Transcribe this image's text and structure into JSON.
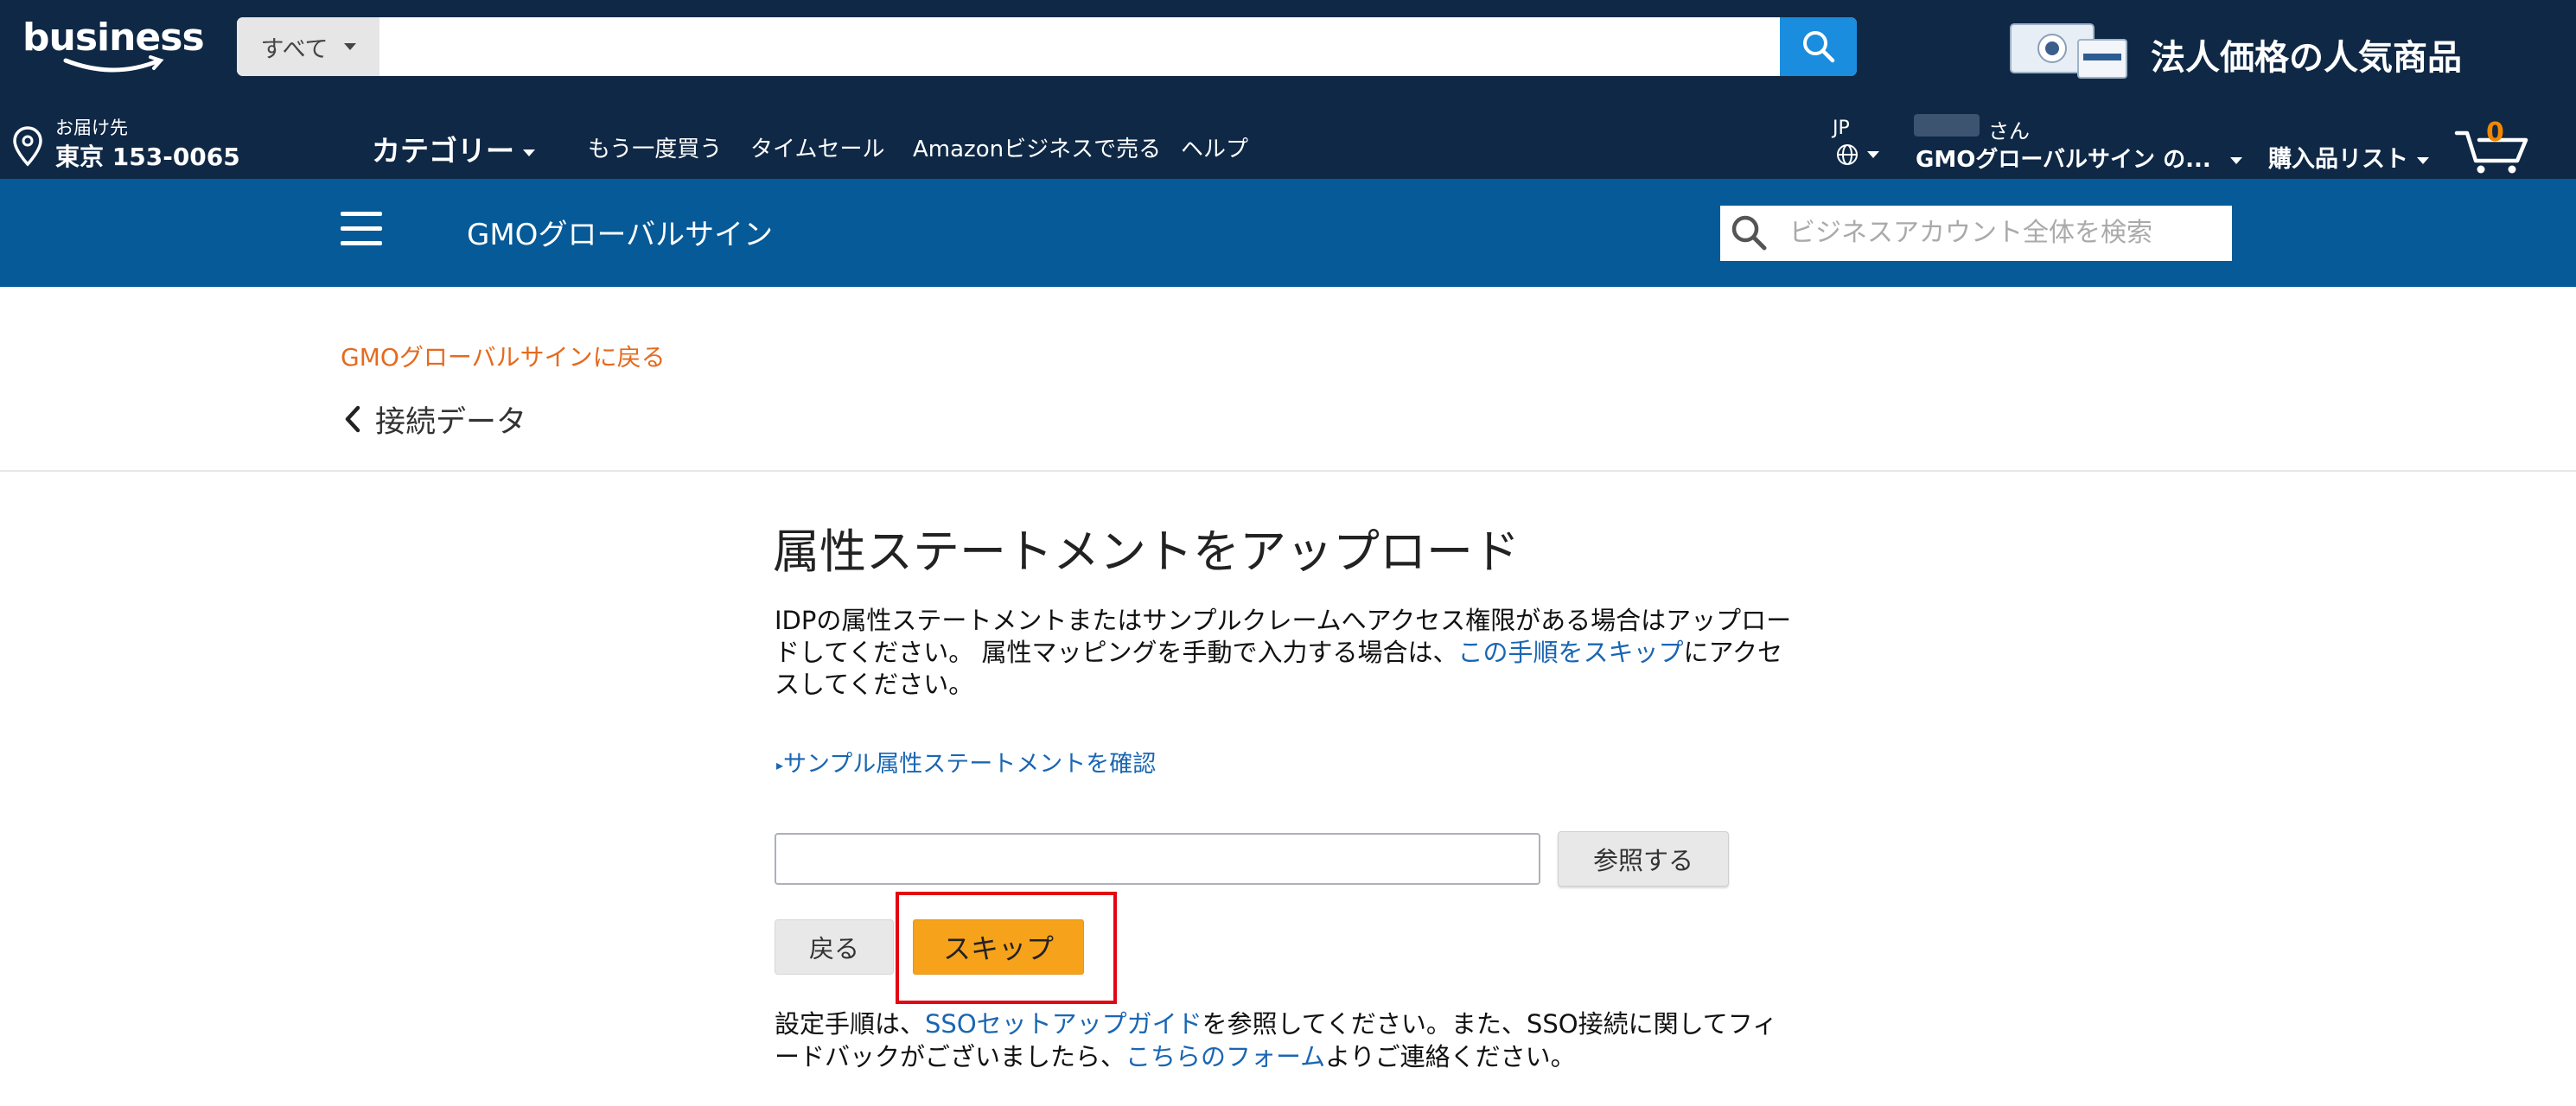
{
  "header": {
    "logo": "business",
    "search_dept": "すべて",
    "search_placeholder": "",
    "promo": "法人価格の人気商品",
    "location_label": "お届け先",
    "location_value": "東京 153-0065",
    "category": "カテゴリー",
    "nav_links": [
      "もう一度買う",
      "タイムセール",
      "Amazonビジネスで売る",
      "ヘルプ"
    ],
    "language": "JP",
    "greeting_suffix": "さん",
    "account_name": "GMOグローバルサイン の...",
    "purchase_list": "購入品リスト",
    "cart_count": "0"
  },
  "subheader": {
    "title": "GMOグローバルサイン",
    "search_placeholder": "ビジネスアカウント全体を検索"
  },
  "breadcrumb": {
    "back_link": "GMOグローバルサインに戻る",
    "current": "接続データ"
  },
  "main": {
    "title": "属性ステートメントをアップロード",
    "desc_part1": "IDPの属性ステートメントまたはサンプルクレームへアクセス権限がある場合はアップロードしてください。 属性マッピングを手動で入力する場合は、",
    "desc_link": "この手順をスキップ",
    "desc_part2": "にアクセスしてください。",
    "sample_link": "サンプル属性ステートメントを確認",
    "file_value": "",
    "browse_label": "参照する",
    "back_label": "戻る",
    "skip_label": "スキップ",
    "footer_part1": "設定手順は、",
    "footer_link1": "SSOセットアップガイド",
    "footer_part2": "を参照してください。また、SSO接続に関してフィードバックがございましたら、",
    "footer_link2": "こちらのフォーム",
    "footer_part3": "よりご連絡ください。"
  },
  "colors": {
    "topbar": "#0f2845",
    "subbar": "#055a97",
    "accent_orange": "#e46a1e",
    "link_blue": "#1a66b3",
    "skip_yellow": "#f7a21b",
    "highlight_red": "#e30613"
  }
}
